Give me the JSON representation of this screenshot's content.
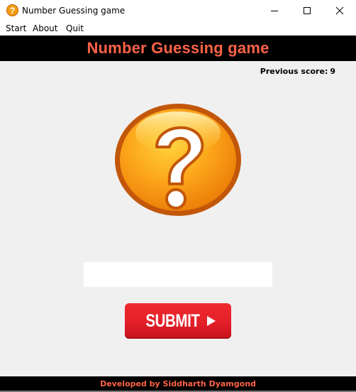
{
  "window": {
    "title": "Number Guessing game",
    "icon": "question-mark-icon",
    "controls": [
      "minimize-icon",
      "maximize-icon",
      "close-icon"
    ]
  },
  "menu": {
    "items": [
      {
        "label": "Start"
      },
      {
        "label": "About"
      },
      {
        "label": "Quit"
      }
    ]
  },
  "header": {
    "title": "Number Guessing game",
    "title_color": "#ff6347",
    "background": "#000000"
  },
  "score": {
    "label": "Previous score:",
    "value": "9"
  },
  "logo": {
    "icon": "question-mark-icon"
  },
  "guess_input": {
    "value": "",
    "placeholder": ""
  },
  "submit": {
    "label": "SUBMIT",
    "icon": "play-icon",
    "color": "#e5202a"
  },
  "footer": {
    "text": "Developed by Siddharth Dyamgond"
  }
}
